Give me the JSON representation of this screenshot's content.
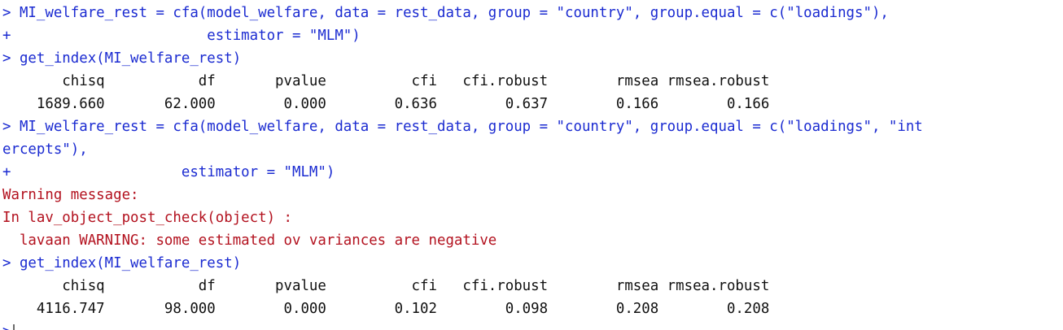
{
  "console": {
    "lines": [
      {
        "kind": "in",
        "text": "> MI_welfare_rest = cfa(model_welfare, data = rest_data, group = \"country\", group.equal = c(\"loadings\"),"
      },
      {
        "kind": "in",
        "text": "+                       estimator = \"MLM\")"
      },
      {
        "kind": "in",
        "text": "> get_index(MI_welfare_rest)"
      },
      {
        "kind": "out",
        "text": "       chisq           df       pvalue          cfi   cfi.robust        rmsea rmsea.robust"
      },
      {
        "kind": "out",
        "text": "    1689.660       62.000        0.000        0.636        0.637        0.166        0.166"
      },
      {
        "kind": "in",
        "text": "> MI_welfare_rest = cfa(model_welfare, data = rest_data, group = \"country\", group.equal = c(\"loadings\", \"int"
      },
      {
        "kind": "in",
        "text": "ercepts\"),"
      },
      {
        "kind": "in",
        "text": "+                    estimator = \"MLM\")"
      },
      {
        "kind": "warn",
        "text": "Warning message:"
      },
      {
        "kind": "warn",
        "text": "In lav_object_post_check(object) :"
      },
      {
        "kind": "warn",
        "text": "  lavaan WARNING: some estimated ov variances are negative"
      },
      {
        "kind": "in",
        "text": "> get_index(MI_welfare_rest)"
      },
      {
        "kind": "out",
        "text": "       chisq           df       pvalue          cfi   cfi.robust        rmsea rmsea.robust"
      },
      {
        "kind": "out",
        "text": "    4116.747       98.000        0.000        0.102        0.098        0.208        0.208"
      }
    ],
    "prompt": ">"
  },
  "colors": {
    "input": "#1b2bd1",
    "output": "#111111",
    "warning": "#b3121f"
  }
}
